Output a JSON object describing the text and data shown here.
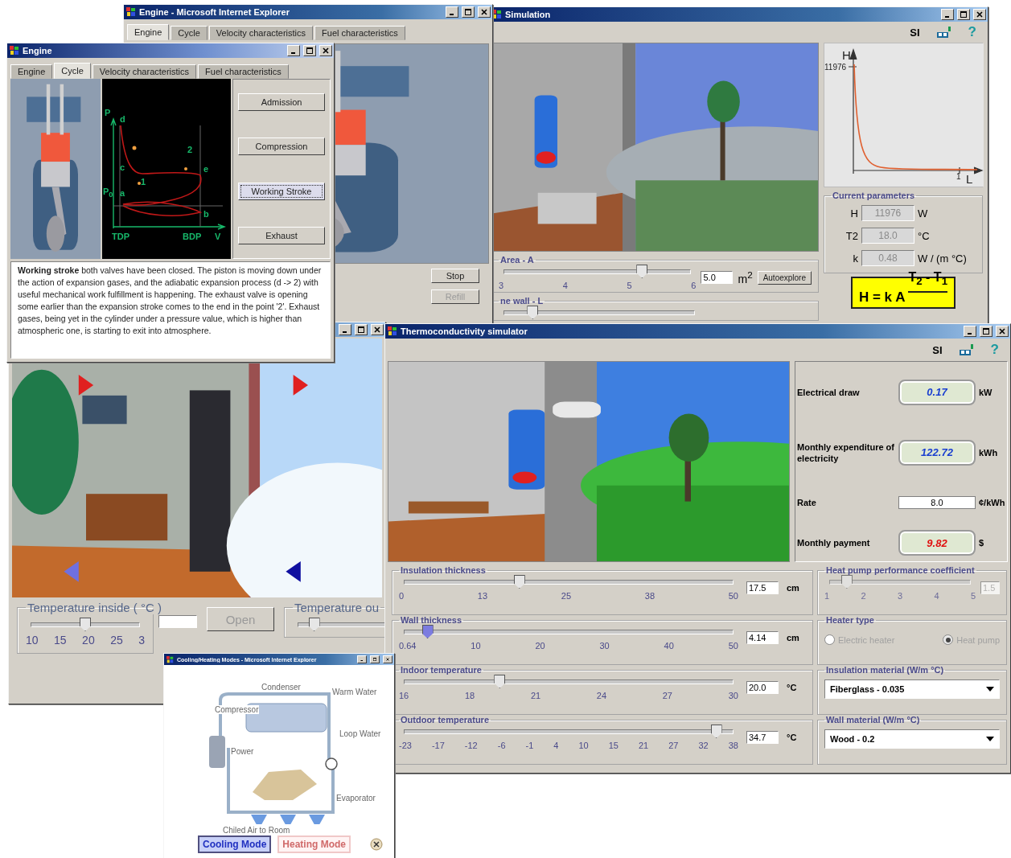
{
  "engine_browser": {
    "title": "Engine - Microsoft Internet Explorer",
    "tabs": [
      {
        "label": "Engine",
        "selected": true
      },
      {
        "label": "Cycle",
        "selected": false
      },
      {
        "label": "Velocity characteristics",
        "selected": false
      },
      {
        "label": "Fuel characteristics",
        "selected": false
      }
    ],
    "buttons": [
      {
        "label": "Stop",
        "disabled": false
      },
      {
        "label": "Refill",
        "disabled": true
      }
    ]
  },
  "simulation": {
    "title": "Simulation",
    "units_label": "SI",
    "help": "?",
    "graph": {
      "y_axis": "H",
      "y_tick": "11976",
      "x_tick": "1",
      "x_axis": "L"
    },
    "parameters": {
      "title": "Current parameters",
      "rows": [
        {
          "label": "H",
          "value": "11976",
          "unit": "W"
        },
        {
          "label": "T2",
          "value": "18.0",
          "unit": "°C"
        },
        {
          "label": "k",
          "value": "0.48",
          "unit": "W / (m °C)"
        }
      ]
    },
    "area": {
      "title": "Area - A",
      "ticks": [
        "3",
        "4",
        "5",
        "6"
      ],
      "level": 0.74,
      "value": "5.0",
      "unit": "m$^{2}$",
      "button": "Autoexplore"
    },
    "wall": {
      "title": "ne wall - L",
      "level": 0.15
    },
    "formula": {
      "lhs": "H = k A",
      "numerator": "T$_{2}$ - T$_{1}$"
    }
  },
  "room": {
    "inside": {
      "title": "Temperature inside ( °C )",
      "level": 0.5,
      "ticks": [
        "10",
        "15",
        "20",
        "25",
        "3"
      ]
    },
    "open_button": {
      "label": "Open",
      "disabled": true
    },
    "outside": {
      "title": "Temperature ou",
      "level": 0.1
    }
  },
  "engine": {
    "title": "Engine",
    "tabs": [
      {
        "label": "Engine",
        "selected": false
      },
      {
        "label": "Cycle",
        "selected": true
      },
      {
        "label": "Velocity characteristics",
        "selected": false
      },
      {
        "label": "Fuel characteristics",
        "selected": false
      }
    ],
    "diagram": {
      "labels": [
        "P",
        "d",
        "c",
        "P$_{0}$",
        "a",
        "1",
        "2",
        "e",
        "b",
        "TDP",
        "BDP",
        "V"
      ]
    },
    "buttons": [
      {
        "label": "Admission",
        "selected": false
      },
      {
        "label": "Compression",
        "selected": false
      },
      {
        "label": "Working Stroke",
        "selected": true
      },
      {
        "label": "Exhaust",
        "selected": false
      }
    ],
    "description": "**Working stroke** both valves have been closed. The piston is moving down under the action of expansion gases, and the adiabatic expansion process (d -> 2) with useful mechanical work fulfillment is happening. The exhaust valve is opening some earlier than the expansion stroke comes to the end in the point '2'. Exhaust gases, being yet in the cylinder under a pressure value, which is higher than atmospheric one, is starting to exit into atmosphere."
  },
  "thermo": {
    "title": "Thermoconductivity simulator",
    "units_label": "SI",
    "help": "?",
    "readouts": [
      {
        "kind": "display",
        "label": "Electrical draw",
        "value": "0.17",
        "unit": "kW",
        "color": "#1a3fd0"
      },
      {
        "kind": "display",
        "label": "Monthly expenditure of electricity",
        "value": "122.72",
        "unit": "kWh",
        "color": "#1a3fd0"
      },
      {
        "kind": "input",
        "label": "Rate",
        "value": "8.0",
        "unit": "¢/kWh"
      },
      {
        "kind": "display",
        "label": "Monthly payment",
        "value": "9.82",
        "unit": "$",
        "color": "#e01010"
      }
    ],
    "sliders": [
      {
        "title": "Insulation thickness",
        "ticks": [
          "0",
          "13",
          "25",
          "38",
          "50"
        ],
        "level": 0.35,
        "value": "17.5",
        "unit": "cm",
        "focused": false
      },
      {
        "title": "Wall thickness",
        "ticks": [
          "0.64",
          "10",
          "20",
          "30",
          "40",
          "50"
        ],
        "level": 0.07,
        "value": "4.14",
        "unit": "cm",
        "focused": true
      },
      {
        "title": "Indoor temperature",
        "ticks": [
          "16",
          "18",
          "21",
          "24",
          "27",
          "30"
        ],
        "level": 0.29,
        "value": "20.0",
        "unit": "°C",
        "focused": false
      },
      {
        "title": "Outdoor temperature",
        "ticks": [
          "-23",
          "-17",
          "-12",
          "-6",
          "-1",
          "4",
          "10",
          "15",
          "21",
          "27",
          "32",
          "38"
        ],
        "level": 0.95,
        "value": "34.7",
        "unit": "°C",
        "focused": false
      }
    ],
    "pump": {
      "title": "Heat pump performance coefficient",
      "ticks": [
        "1",
        "2",
        "3",
        "4",
        "5"
      ],
      "level": 0.12,
      "value": "1.5",
      "disabled": true
    },
    "heater": {
      "title": "Heater type",
      "disabled": true,
      "options": [
        {
          "label": "Electric heater",
          "selected": false
        },
        {
          "label": "Heat pump",
          "selected": true
        }
      ]
    },
    "selects": [
      {
        "title": "Insulation material (W/m °C)",
        "value": "Fiberglass - 0.035"
      },
      {
        "title": "Wall material (W/m °C)",
        "value": "Wood - 0.2"
      }
    ]
  },
  "cooling": {
    "title": "Cooling/Heating Modes - Microsoft Internet Explorer",
    "labels": [
      "Condenser",
      "Warm Water",
      "Compressor",
      "Loop Water",
      "Power",
      "Evaporator",
      "Chiled Air to Room"
    ],
    "modes": [
      {
        "label": "Cooling Mode",
        "selected": true
      },
      {
        "label": "Heating Mode",
        "selected": false
      }
    ]
  }
}
